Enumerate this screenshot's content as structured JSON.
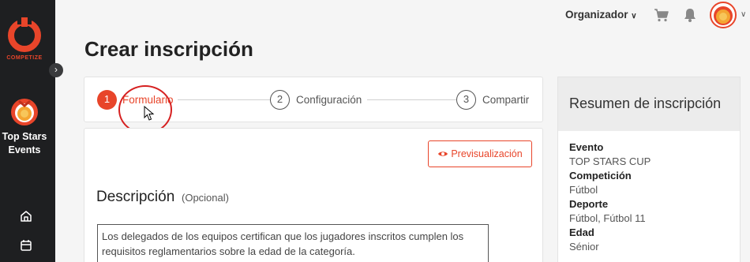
{
  "sidebar": {
    "brand": "COMPETIZE",
    "org_name": "Top Stars Events"
  },
  "topbar": {
    "role": "Organizador"
  },
  "page": {
    "title": "Crear inscripción"
  },
  "stepper": {
    "steps": [
      {
        "number": "1",
        "label": "Formulario"
      },
      {
        "number": "2",
        "label": "Configuración"
      },
      {
        "number": "3",
        "label": "Compartir"
      }
    ]
  },
  "form": {
    "preview_label": "Previsualización",
    "description_title": "Descripción",
    "description_optional": "(Opcional)",
    "description_value": "Los delegados de los equipos certifican que los jugadores inscritos cumplen los requisitos reglamentarios sobre la edad de la categoría."
  },
  "summary": {
    "title": "Resumen de inscripción",
    "items": [
      {
        "label": "Evento",
        "value": "TOP STARS CUP"
      },
      {
        "label": "Competición",
        "value": "Fútbol"
      },
      {
        "label": "Deporte",
        "value": "Fútbol, Fútbol 11"
      },
      {
        "label": "Edad",
        "value": "Sénior"
      }
    ]
  },
  "colors": {
    "accent": "#e8452a",
    "sidebar": "#1e1f21"
  }
}
